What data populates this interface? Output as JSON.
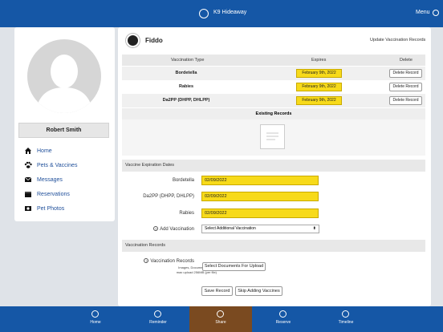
{
  "header": {
    "title": "K9 Hideaway",
    "menu_label": "Menu"
  },
  "user": {
    "name": "Robert Smith"
  },
  "sidebar": {
    "items": [
      {
        "label": "Home",
        "icon": "home-icon"
      },
      {
        "label": "Pets & Vaccines",
        "icon": "paw-icon"
      },
      {
        "label": "Messages",
        "icon": "envelope-icon"
      },
      {
        "label": "Reservations",
        "icon": "calendar-icon"
      },
      {
        "label": "Pet Photos",
        "icon": "photo-icon"
      }
    ]
  },
  "pet": {
    "name": "Fiddo"
  },
  "page": {
    "title": "Update Vaccination Records"
  },
  "table": {
    "headers": [
      "Vaccination Type",
      "Expires",
      "Delete"
    ],
    "rows": [
      {
        "type": "Bordetella",
        "expires": "February 9th, 2022",
        "delete_label": "Delete Record"
      },
      {
        "type": "Rabies",
        "expires": "February 9th, 2022",
        "delete_label": "Delete Record"
      },
      {
        "type": "Da2PP (DHPP, DHLPP)",
        "expires": "February 9th, 2022",
        "delete_label": "Delete Record"
      }
    ]
  },
  "existing_records": {
    "header": "Existing Records"
  },
  "expiration_section": {
    "header": "Vaccine Expiration Dates",
    "fields": [
      {
        "label": "Bordetella",
        "value": "02/09/2022"
      },
      {
        "label": "Da2PP (DHPP, DHLPP)",
        "value": "02/09/2022"
      },
      {
        "label": "Rabies",
        "value": "02/09/2022"
      }
    ],
    "add_vaccination": {
      "label": "Add Vaccination",
      "selected": "Select Additional Vaccination"
    }
  },
  "records_section": {
    "header": "Vaccination Records",
    "label": "Vaccination Records",
    "note_line1": "Images, Documents, PDFs",
    "note_line2": "max upload 256MB (per file)",
    "upload_button": "Select Documents For Upload"
  },
  "actions": {
    "save": "Save Record",
    "skip": "Skip Adding Vaccines"
  },
  "bottom_nav": {
    "items": [
      {
        "label": "Home",
        "icon": "home-icon"
      },
      {
        "label": "Reminder",
        "icon": "bell-icon"
      },
      {
        "label": "Share",
        "icon": "share-icon",
        "active": true
      },
      {
        "label": "Reserve",
        "icon": "plus-icon"
      },
      {
        "label": "Timeline",
        "icon": "timeline-icon"
      }
    ]
  },
  "colors": {
    "primary": "#1557a6",
    "highlight": "#f7da1a",
    "active_tab": "#7a4a20"
  }
}
